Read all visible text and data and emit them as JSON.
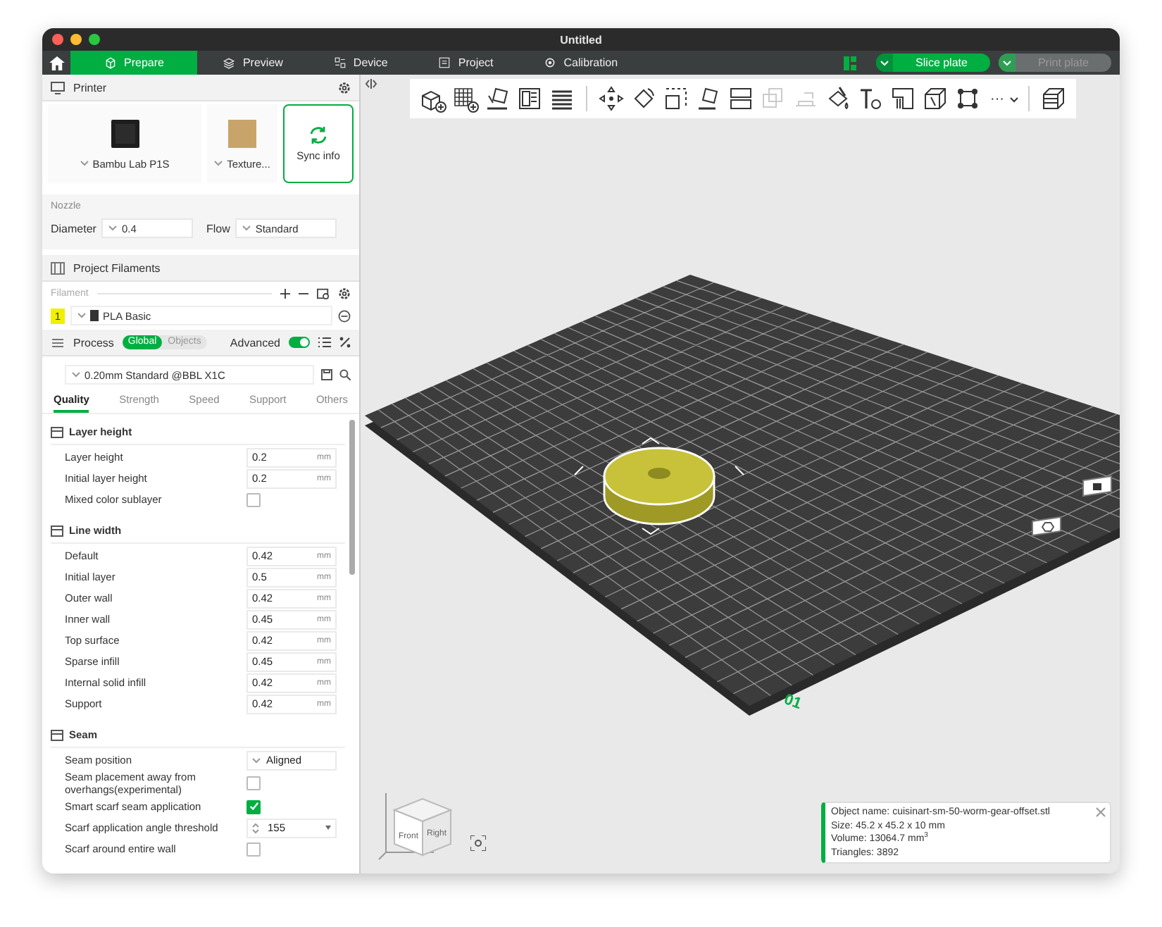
{
  "window": {
    "title": "Untitled"
  },
  "tabs": [
    {
      "label": "Prepare",
      "selected": true
    },
    {
      "label": "Preview",
      "selected": false
    },
    {
      "label": "Device",
      "selected": false
    },
    {
      "label": "Project",
      "selected": false
    },
    {
      "label": "Calibration",
      "selected": false
    }
  ],
  "actions": {
    "slice": {
      "label": "Slice plate",
      "disabled": false
    },
    "print": {
      "label": "Print plate",
      "disabled": true
    }
  },
  "printer": {
    "title": "Printer",
    "printer_name": "Bambu Lab P1S",
    "plate": "Texture...",
    "sync": "Sync info",
    "nozzle_label": "Nozzle",
    "diameter_label": "Diameter",
    "diameter": "0.4",
    "flow_label": "Flow",
    "flow": "Standard"
  },
  "filaments": {
    "title": "Project Filaments",
    "filament_label": "Filament",
    "items": [
      {
        "index": "1",
        "name": "PLA Basic",
        "color": "#f0f000"
      }
    ]
  },
  "process": {
    "title": "Process",
    "scope": [
      {
        "label": "Global",
        "selected": true
      },
      {
        "label": "Objects",
        "selected": false
      }
    ],
    "advanced_label": "Advanced",
    "advanced_on": true,
    "preset": "0.20mm Standard @BBL X1C",
    "tabs": [
      {
        "label": "Quality",
        "selected": true
      },
      {
        "label": "Strength",
        "selected": false
      },
      {
        "label": "Speed",
        "selected": false
      },
      {
        "label": "Support",
        "selected": false
      },
      {
        "label": "Others",
        "selected": false
      }
    ],
    "groups": [
      {
        "title": "Layer height",
        "rows": [
          {
            "kind": "number",
            "label": "Layer height",
            "value": "0.2",
            "unit": "mm"
          },
          {
            "kind": "number",
            "label": "Initial layer height",
            "value": "0.2",
            "unit": "mm"
          },
          {
            "kind": "checkbox",
            "label": "Mixed color sublayer",
            "checked": false
          }
        ]
      },
      {
        "title": "Line width",
        "rows": [
          {
            "kind": "number",
            "label": "Default",
            "value": "0.42",
            "unit": "mm"
          },
          {
            "kind": "number",
            "label": "Initial layer",
            "value": "0.5",
            "unit": "mm"
          },
          {
            "kind": "number",
            "label": "Outer wall",
            "value": "0.42",
            "unit": "mm"
          },
          {
            "kind": "number",
            "label": "Inner wall",
            "value": "0.45",
            "unit": "mm"
          },
          {
            "kind": "number",
            "label": "Top surface",
            "value": "0.42",
            "unit": "mm"
          },
          {
            "kind": "number",
            "label": "Sparse infill",
            "value": "0.45",
            "unit": "mm"
          },
          {
            "kind": "number",
            "label": "Internal solid infill",
            "value": "0.42",
            "unit": "mm"
          },
          {
            "kind": "number",
            "label": "Support",
            "value": "0.42",
            "unit": "mm"
          }
        ]
      },
      {
        "title": "Seam",
        "rows": [
          {
            "kind": "select",
            "label": "Seam position",
            "value": "Aligned"
          },
          {
            "kind": "checkbox",
            "label": "Seam placement away from overhangs(experimental)",
            "checked": false
          },
          {
            "kind": "checkbox",
            "label": "Smart scarf seam application",
            "checked": true
          },
          {
            "kind": "spin",
            "label": "Scarf application angle threshold",
            "value": "155"
          },
          {
            "kind": "checkbox",
            "label": "Scarf around entire wall",
            "checked": false
          }
        ]
      }
    ]
  },
  "toolbar": {
    "tools": [
      {
        "disabled": false
      },
      {
        "disabled": false
      },
      {
        "disabled": false
      },
      {
        "disabled": false
      },
      {
        "disabled": false
      },
      {
        "disabled": false
      },
      {
        "disabled": false
      },
      {
        "disabled": false
      },
      {
        "disabled": false
      },
      {
        "disabled": false
      },
      {
        "disabled": true
      },
      {
        "disabled": true
      },
      {
        "disabled": false
      },
      {
        "disabled": false
      },
      {
        "disabled": false
      },
      {
        "disabled": false
      },
      {
        "disabled": false
      },
      {
        "disabled": false
      }
    ],
    "more": "···"
  },
  "viewport": {
    "plate_number": "01",
    "cube_labels": [
      "Front",
      "Right"
    ],
    "object_info": [
      "Object name: cuisinart-sm-50-worm-gear-offset.stl",
      "Size: 45.2 x 45.2 x 10 mm",
      "Volume: 13064.7 mm$^{3}$",
      "Triangles: 3892"
    ]
  }
}
